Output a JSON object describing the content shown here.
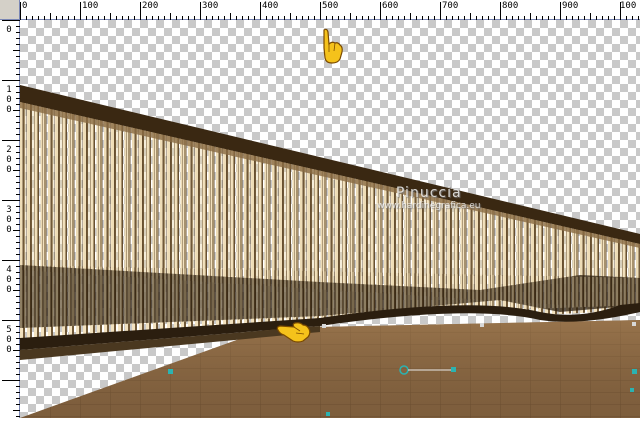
{
  "ruler": {
    "top_labels": [
      "0",
      "100",
      "200",
      "300",
      "400",
      "500",
      "600",
      "700",
      "800",
      "900",
      "100"
    ],
    "left_labels": [
      {
        "digits": [
          "0"
        ]
      },
      {
        "digits": [
          "1",
          "0",
          "0"
        ]
      },
      {
        "digits": [
          "2",
          "0",
          "0"
        ]
      },
      {
        "digits": [
          "3",
          "0",
          "0"
        ]
      },
      {
        "digits": [
          "4",
          "0",
          "0"
        ]
      },
      {
        "digits": [
          "5",
          "0",
          "0"
        ]
      }
    ]
  },
  "watermark": {
    "line1": "Pinuccia",
    "line2": "www.hardinegrafica.eu"
  },
  "icons": {
    "pointer_top": "pointing-hand-icon",
    "pointer_left": "pointing-hand-icon"
  },
  "colors": {
    "rail_dark": "#3a2812",
    "floor": "#8c6a45",
    "accent": "#2bb3b1",
    "ruler_border": "#7a86b4"
  }
}
